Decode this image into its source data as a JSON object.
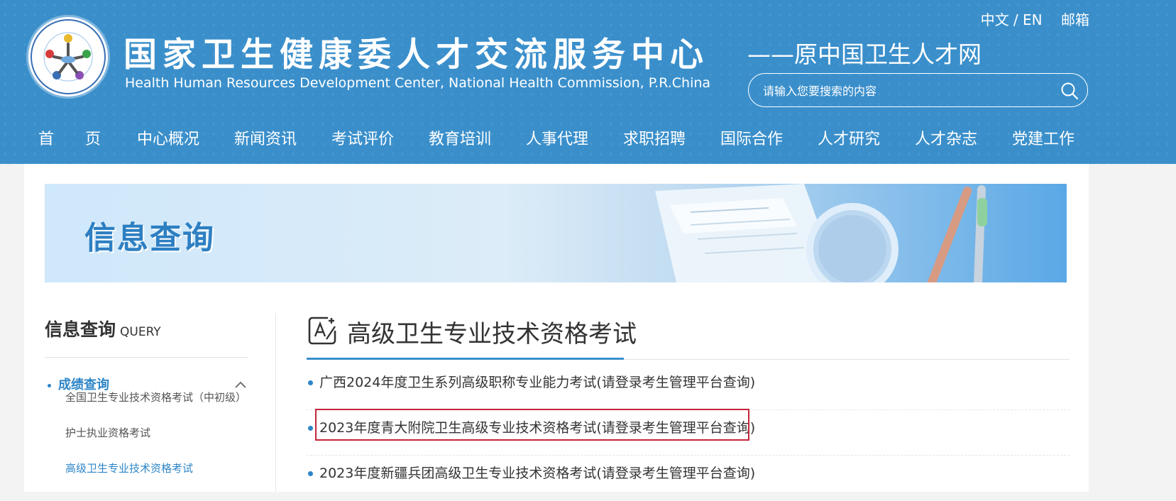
{
  "header": {
    "title": "国家卫生健康委人才交流服务中心",
    "subtitle": "Health Human Resources Development Center, National Health Commission, P.R.China",
    "slogan": "——原中国卫生人才网",
    "lang_switch": "中文 / EN",
    "mail": "邮箱",
    "search_placeholder": "请输入您要搜索的内容",
    "logo_text": "国家卫生健康委人才交流服务中心"
  },
  "nav": {
    "items": [
      "首　　页",
      "中心概况",
      "新闻资讯",
      "考试评价",
      "教育培训",
      "人事代理",
      "求职招聘",
      "国际合作",
      "人才研究",
      "人才杂志",
      "党建工作"
    ]
  },
  "banner": {
    "title": "信息查询"
  },
  "sidebar": {
    "title": "信息查询",
    "title_en": "QUERY",
    "active_item": "成绩查询",
    "sub_items": [
      "全国卫生专业技术资格考试（中初级）",
      "护士执业资格考试",
      "高级卫生专业技术资格考试"
    ]
  },
  "content": {
    "title": "高级卫生专业技术资格考试",
    "items": [
      "广西2024年度卫生系列高级职称专业能力考试(请登录考生管理平台查询)",
      "2023年度青大附院卫生高级专业技术资格考试(请登录考生管理平台查询)",
      "2023年度新疆兵团高级卫生专业技术资格考试(请登录考生管理平台查询)"
    ]
  },
  "colors": {
    "header_bg": "#3a8fcb",
    "accent": "#2e86c8",
    "highlight": "#c3263a"
  }
}
